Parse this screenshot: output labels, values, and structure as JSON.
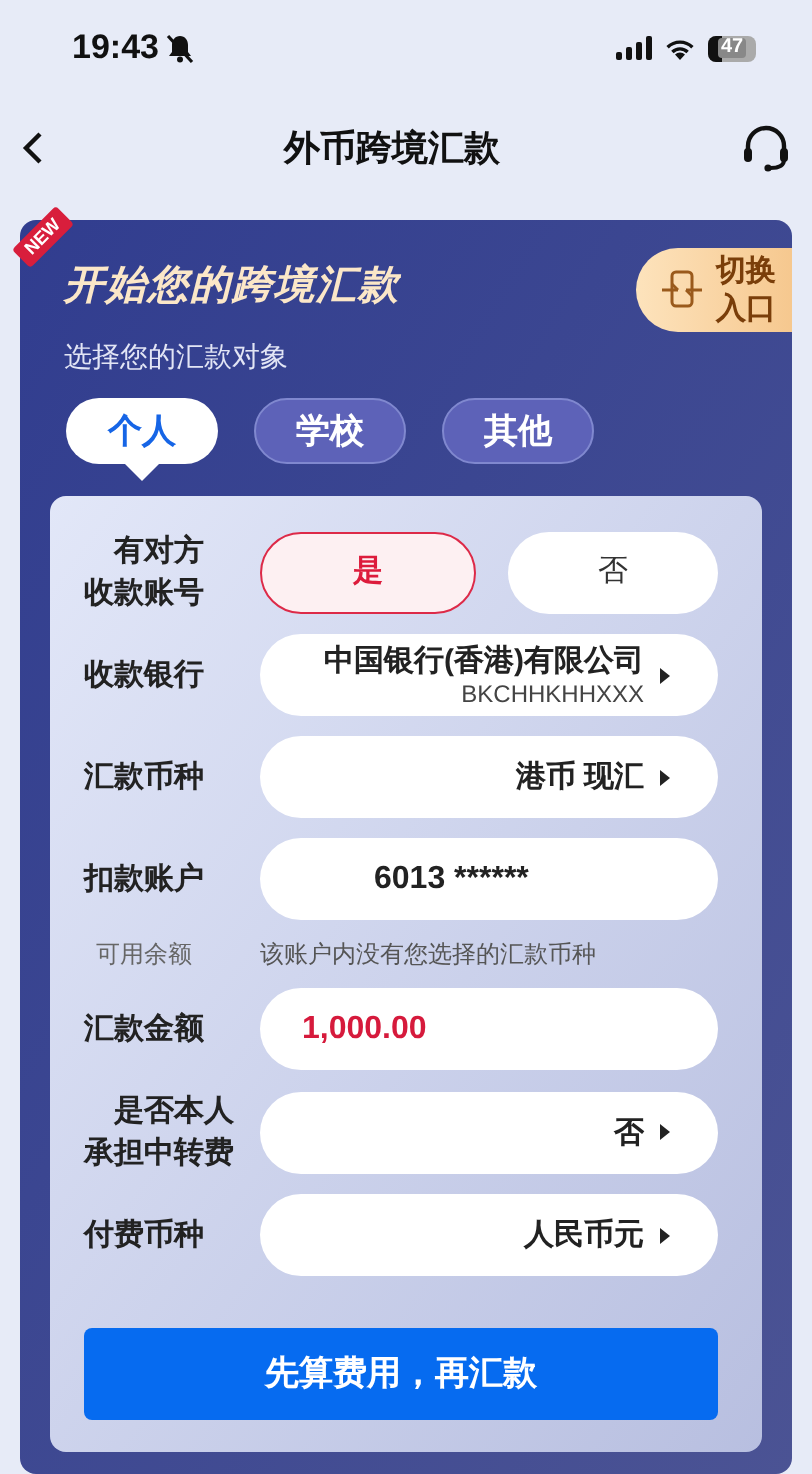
{
  "status_bar": {
    "time": "19:43",
    "battery": "47"
  },
  "header": {
    "title": "外币跨境汇款"
  },
  "card": {
    "badge": "NEW",
    "title": "开始您的跨境汇款",
    "switch_button": "切换入口",
    "subtitle": "选择您的汇款对象",
    "tabs": [
      {
        "label": "个人",
        "selected": true
      },
      {
        "label": "学校",
        "selected": false
      },
      {
        "label": "其他",
        "selected": false
      }
    ]
  },
  "form": {
    "fields": [
      {
        "kind": "toggle",
        "label": "有对方收款账号",
        "options": [
          {
            "label": "是",
            "selected": true
          },
          {
            "label": "否",
            "selected": false
          }
        ]
      },
      {
        "kind": "select",
        "label": "收款银行",
        "value": "中国银行(香港)有限公司",
        "sub": "BKCHHKHHXXX"
      },
      {
        "kind": "select",
        "label": "汇款币种",
        "value": "港币 现汇"
      },
      {
        "kind": "account",
        "label": "扣款账户",
        "value": "6013 ******"
      },
      {
        "kind": "note",
        "label": "可用余额",
        "value": "该账户内没有您选择的汇款币种"
      },
      {
        "kind": "amount",
        "label": "汇款金额",
        "value": "1,000.00"
      },
      {
        "kind": "select",
        "label": "是否本人承担中转费",
        "value": "否"
      },
      {
        "kind": "select",
        "label": "付费币种",
        "value": "人民币元"
      }
    ],
    "submit": "先算费用，再汇款"
  }
}
